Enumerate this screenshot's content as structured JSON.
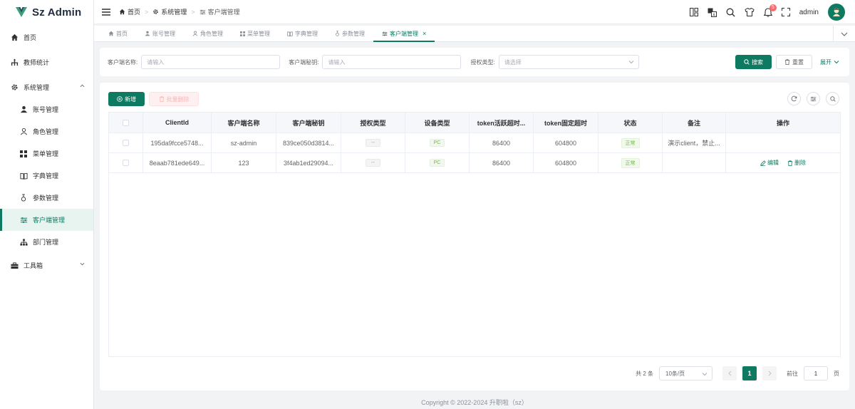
{
  "app": {
    "name": "Sz Admin",
    "accent": "#0f7a62"
  },
  "sidebar": {
    "items": [
      {
        "label": "首页",
        "icon": "home-icon"
      },
      {
        "label": "教师统计",
        "icon": "chart-icon"
      },
      {
        "label": "系统管理",
        "icon": "gear-icon",
        "expanded": true
      },
      {
        "label": "账号管理",
        "icon": "user-icon"
      },
      {
        "label": "角色管理",
        "icon": "user-outline-icon"
      },
      {
        "label": "菜单管理",
        "icon": "grid-icon"
      },
      {
        "label": "字典管理",
        "icon": "book-icon"
      },
      {
        "label": "参数管理",
        "icon": "param-icon"
      },
      {
        "label": "客户端管理",
        "icon": "sliders-icon",
        "active": true
      },
      {
        "label": "部门管理",
        "icon": "org-icon"
      },
      {
        "label": "工具箱",
        "icon": "toolbox-icon"
      }
    ]
  },
  "header": {
    "breadcrumb": [
      "首页",
      "系统管理",
      "客户端管理"
    ],
    "notification_count": "5",
    "username": "admin"
  },
  "tabs": [
    {
      "label": "首页"
    },
    {
      "label": "账号管理"
    },
    {
      "label": "角色管理"
    },
    {
      "label": "菜单管理"
    },
    {
      "label": "字典管理"
    },
    {
      "label": "参数管理"
    },
    {
      "label": "客户端管理",
      "active": true
    }
  ],
  "search": {
    "client_name_label": "客户端名称:",
    "client_name_placeholder": "请输入",
    "client_secret_label": "客户端秘钥:",
    "client_secret_placeholder": "请输入",
    "grant_type_label": "授权类型:",
    "grant_type_placeholder": "请选择",
    "search_button": "搜索",
    "reset_button": "重置",
    "expand_button": "展开"
  },
  "toolbar": {
    "add_button": "新增",
    "batch_delete_button": "批量删除"
  },
  "table": {
    "columns": [
      "ClientId",
      "客户端名称",
      "客户端秘钥",
      "授权类型",
      "设备类型",
      "token活跃超时...",
      "token固定超时",
      "状态",
      "备注",
      "操作"
    ],
    "rows": [
      {
        "client_id": "195da9fcce5748...",
        "name": "sz-admin",
        "secret": "839ce050d3814...",
        "grant_type": "--",
        "device_type": "PC",
        "active_timeout": "86400",
        "fixed_timeout": "604800",
        "status": "正常",
        "remark": "演示client，禁止...",
        "actions": []
      },
      {
        "client_id": "8eaab781ede649...",
        "name": "123",
        "secret": "3f4ab1ed29094...",
        "grant_type": "--",
        "device_type": "PC",
        "active_timeout": "86400",
        "fixed_timeout": "604800",
        "status": "正常",
        "remark": "",
        "actions": [
          "编辑",
          "删除"
        ]
      }
    ]
  },
  "pagination": {
    "total_text": "共 2 条",
    "page_size": "10条/页",
    "current_page": "1",
    "goto_label": "前往",
    "goto_value": "1",
    "page_suffix": "页"
  },
  "footer": {
    "text": "Copyright © 2022-2024 升职啦（sz）"
  }
}
